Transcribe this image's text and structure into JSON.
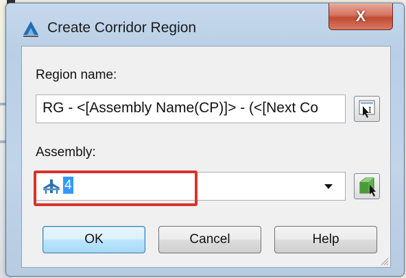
{
  "dialog": {
    "title": "Create Corridor Region",
    "close_glyph": "X",
    "region_name_label": "Region name:",
    "region_name_value": "RG - <[Assembly Name(CP)]> - (<[Next Co",
    "assembly_label": "Assembly:",
    "assembly_value": "4",
    "buttons": {
      "ok": "OK",
      "cancel": "Cancel",
      "help": "Help"
    }
  },
  "icons": {
    "app": "autocad-civil-logo-icon",
    "name_editor": "text-pick-icon",
    "assembly_pick": "pick-assembly-icon",
    "assembly_item": "assembly-icon"
  },
  "colors": {
    "selection": "#3399ff",
    "highlight_box": "#d9322b",
    "close_button": "#c94e37"
  }
}
